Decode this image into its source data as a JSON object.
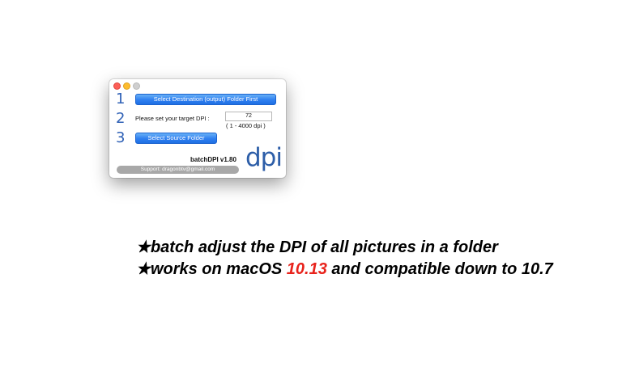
{
  "window": {
    "steps": [
      "1",
      "2",
      "3"
    ],
    "dest_button_label": "Select Destination (output) Folder First",
    "dpi_label": "Please set your target DPI :",
    "dpi_value": "72",
    "dpi_range": "( 1 - 4000 dpi )",
    "source_button_label": "Select Source Folder",
    "app_name": "batchDPI  v1.80",
    "logo_text": "dpi",
    "support_text": "Support: dragonbtv@gmail.com"
  },
  "features": {
    "line1": {
      "star": "★",
      "text": "batch adjust the DPI of all pictures in a folder"
    },
    "line2": {
      "star": "★",
      "prefix": "works on macOS ",
      "version": "10.13",
      "suffix": " and compatible down to 10.7"
    }
  },
  "colors": {
    "accent_blue": "#2f7ff0",
    "version_red": "#e8221b"
  }
}
